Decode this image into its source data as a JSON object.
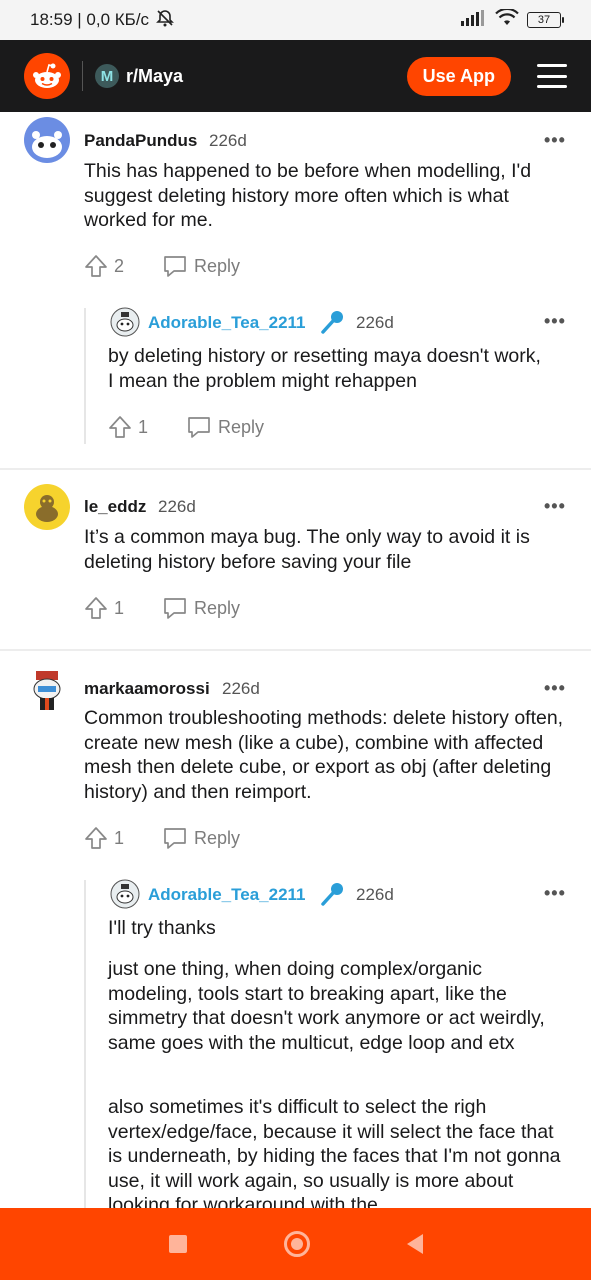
{
  "status_bar": {
    "time_speed": "18:59 | 0,0 КБ/с",
    "battery": "37"
  },
  "header": {
    "subreddit": "r/Maya",
    "subreddit_initial": "M",
    "use_app_label": "Use App"
  },
  "comments": [
    {
      "username": "PandaPundus",
      "age": "226d",
      "body": "This has happened to be before when modelling, I'd suggest deleting history more often which is what worked for me.",
      "votes": "2",
      "reply_label": "Reply"
    },
    {
      "username": "Adorable_Tea_2211",
      "age": "226d",
      "body": "by deleting history or resetting maya doesn't work, I mean the problem might rehappen",
      "votes": "1",
      "reply_label": "Reply"
    },
    {
      "username": "le_eddz",
      "age": "226d",
      "body": "It’s a common maya bug. The only way to avoid it is deleting history before saving your file",
      "votes": "1",
      "reply_label": "Reply"
    },
    {
      "username": "markaamorossi",
      "age": "226d",
      "body": "Common troubleshooting methods: delete history often, create new mesh (like a cube), combine with affected mesh then delete cube, or export as obj (after deleting history) and then reimport.",
      "votes": "1",
      "reply_label": "Reply"
    },
    {
      "username": "Adorable_Tea_2211",
      "age": "226d",
      "paragraphs": [
        "I'll try thanks",
        "just one thing, when doing complex/organic modeling, tools start to breaking apart, like the simmetry that doesn't work anymore or act weirdly, same goes with the multicut, edge loop and etx",
        "also sometimes it's difficult to select the righ vertex/edge/face, because it will select the face that is underneath, by hiding the faces that I'm not gonna use, it will work again, so usually is more about looking for workaround with the"
      ]
    }
  ],
  "more_label": "•••",
  "colors": {
    "accent": "#ff4500",
    "header_bg": "#1a1a1b",
    "op_blue": "#2a9ed8"
  }
}
